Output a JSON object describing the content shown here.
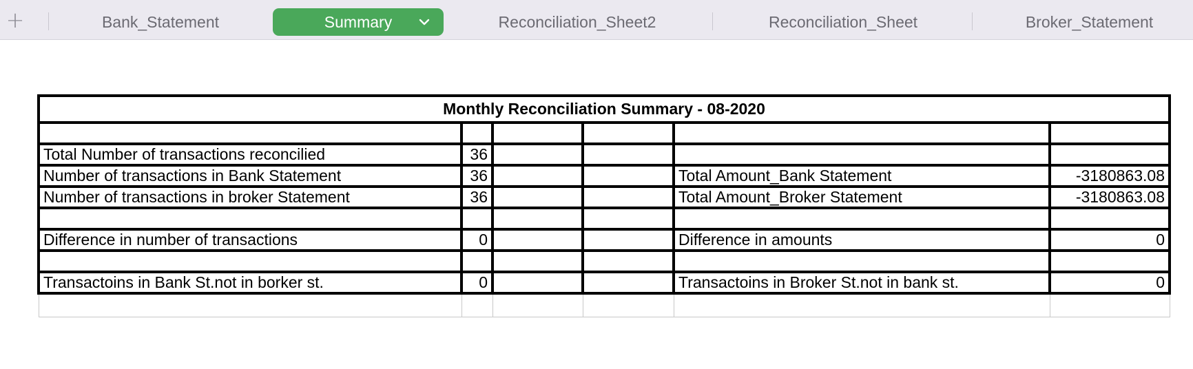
{
  "tabs": {
    "add_label": "+",
    "items": [
      {
        "label": "Bank_Statement",
        "active": false
      },
      {
        "label": "Summary",
        "active": true
      },
      {
        "label": "Reconciliation_Sheet2",
        "active": false
      },
      {
        "label": "Reconciliation_Sheet",
        "active": false
      },
      {
        "label": "Broker_Statement",
        "active": false
      }
    ],
    "active_color": "#4aa85a",
    "active_icon": "chevron-down-icon"
  },
  "summary": {
    "title": "Monthly Reconciliation Summary - 08-2020",
    "rows": {
      "total_reconciled": {
        "label": "Total Number of transactions reconcilied",
        "value": "36"
      },
      "bank_count": {
        "label": "Number of transactions in Bank Statement",
        "value": "36"
      },
      "broker_count": {
        "label": "Number of transactions in broker Statement",
        "value": "36"
      },
      "count_difference": {
        "label": "Difference in number of transactions",
        "value": "0"
      },
      "bank_not_broker": {
        "label": "Transactoins in Bank St.not in borker st.",
        "value": "0"
      }
    },
    "right": {
      "bank_total": {
        "label": "Total Amount_Bank Statement",
        "value": "-3180863.08"
      },
      "broker_total": {
        "label": "Total Amount_Broker Statement",
        "value": "-3180863.08"
      },
      "amount_difference": {
        "label": "Difference in amounts",
        "value": "0"
      },
      "broker_not_bank": {
        "label": "Transactoins in Broker St.not in bank st.",
        "value": "0"
      }
    }
  }
}
